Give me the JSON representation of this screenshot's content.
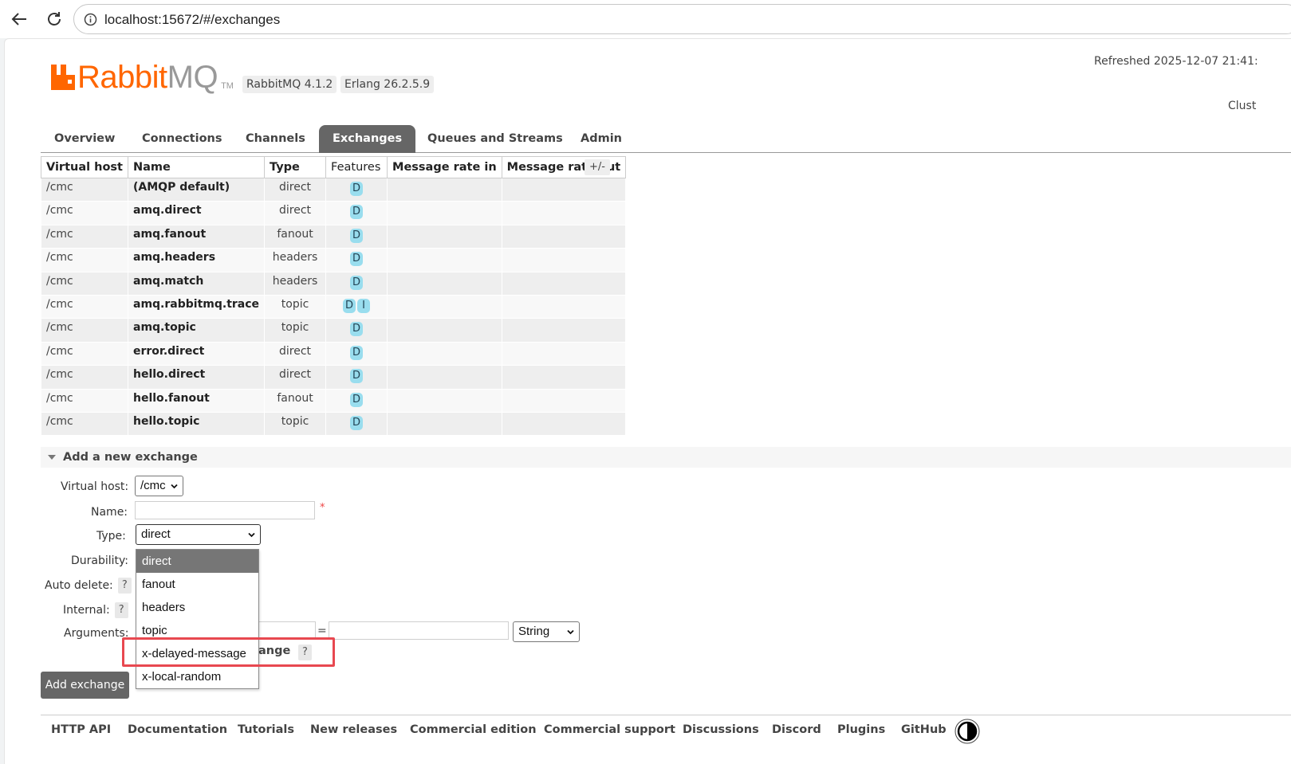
{
  "browser": {
    "url": "localhost:15672/#/exchanges"
  },
  "header": {
    "logo_text_rabbit": "Rabbit",
    "logo_text_mq": "MQ",
    "logo_tm": "TM",
    "rabbitmq_version": "RabbitMQ 4.1.2",
    "erlang_version": "Erlang 26.2.5.9",
    "refreshed": "Refreshed 2025-12-07 21:41:",
    "cluster": "Clust"
  },
  "tabs": [
    {
      "label": "Overview"
    },
    {
      "label": "Connections"
    },
    {
      "label": "Channels"
    },
    {
      "label": "Exchanges",
      "active": true
    },
    {
      "label": "Queues and Streams"
    },
    {
      "label": "Admin"
    }
  ],
  "table": {
    "headers": [
      "Virtual host",
      "Name",
      "Type",
      "Features",
      "Message rate in",
      "Message rate out"
    ],
    "column_toggle": "+/-",
    "rows": [
      {
        "vhost": "/cmc",
        "name": "(AMQP default)",
        "type": "direct",
        "features": [
          "D"
        ]
      },
      {
        "vhost": "/cmc",
        "name": "amq.direct",
        "type": "direct",
        "features": [
          "D"
        ]
      },
      {
        "vhost": "/cmc",
        "name": "amq.fanout",
        "type": "fanout",
        "features": [
          "D"
        ]
      },
      {
        "vhost": "/cmc",
        "name": "amq.headers",
        "type": "headers",
        "features": [
          "D"
        ]
      },
      {
        "vhost": "/cmc",
        "name": "amq.match",
        "type": "headers",
        "features": [
          "D"
        ]
      },
      {
        "vhost": "/cmc",
        "name": "amq.rabbitmq.trace",
        "type": "topic",
        "features": [
          "D",
          "I"
        ]
      },
      {
        "vhost": "/cmc",
        "name": "amq.topic",
        "type": "topic",
        "features": [
          "D"
        ]
      },
      {
        "vhost": "/cmc",
        "name": "error.direct",
        "type": "direct",
        "features": [
          "D"
        ]
      },
      {
        "vhost": "/cmc",
        "name": "hello.direct",
        "type": "direct",
        "features": [
          "D"
        ]
      },
      {
        "vhost": "/cmc",
        "name": "hello.fanout",
        "type": "fanout",
        "features": [
          "D"
        ]
      },
      {
        "vhost": "/cmc",
        "name": "hello.topic",
        "type": "topic",
        "features": [
          "D"
        ]
      }
    ]
  },
  "add_exchange": {
    "section_title": "Add a new exchange",
    "labels": {
      "virtual_host": "Virtual host:",
      "name": "Name:",
      "type": "Type:",
      "durability": "Durability:",
      "auto_delete": "Auto delete:",
      "internal": "Internal:",
      "arguments": "Arguments:"
    },
    "help_mark": "?",
    "required_mark": "*",
    "virtual_host_value": "/cmc",
    "name_value": "",
    "type_value": "direct",
    "equals": "=",
    "arg_type_value": "String",
    "behind_text": "ange",
    "type_options": [
      "direct",
      "fanout",
      "headers",
      "topic",
      "x-delayed-message",
      "x-local-random"
    ],
    "selected_option": "direct",
    "highlighted_option": "x-delayed-message",
    "submit_label": "Add exchange"
  },
  "footer": {
    "links": [
      "HTTP API",
      "Documentation",
      "Tutorials",
      "New releases",
      "Commercial edition",
      "Commercial support",
      "Discussions",
      "Discord",
      "Plugins",
      "GitHub"
    ]
  },
  "colors": {
    "brand_orange": "#ff6600",
    "tab_active_bg": "#666666",
    "feature_badge": "#99ddee",
    "highlight_border": "#e84850"
  }
}
